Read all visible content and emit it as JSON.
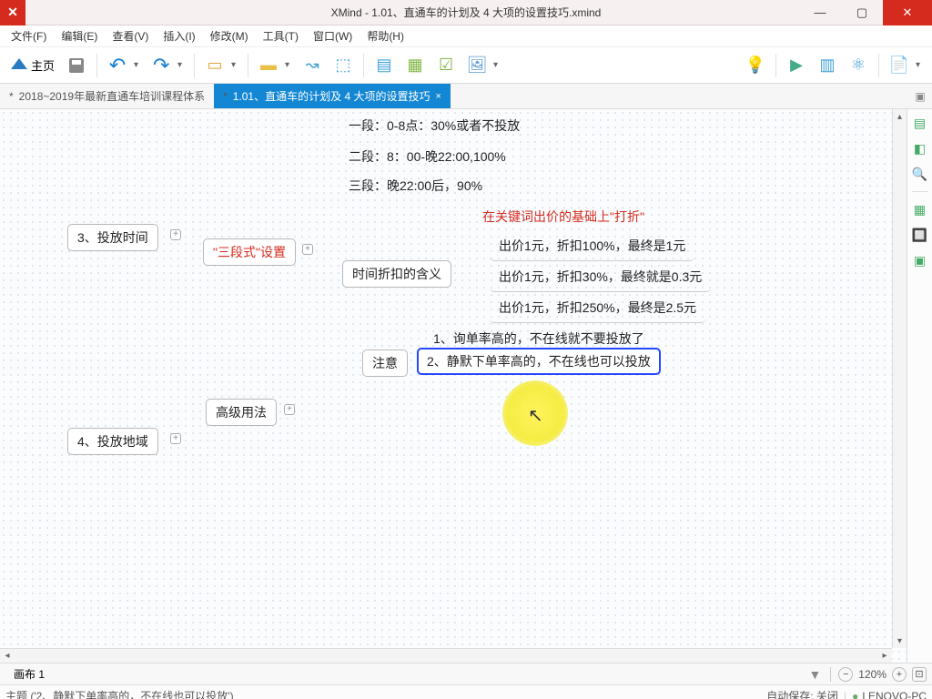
{
  "title": "XMind - 1.01、直通车的计划及 4 大项的设置技巧.xmind",
  "menu": [
    "文件(F)",
    "编辑(E)",
    "查看(V)",
    "插入(I)",
    "修改(M)",
    "工具(T)",
    "窗口(W)",
    "帮助(H)"
  ],
  "toolbar": {
    "home": "主页"
  },
  "tabs": {
    "t1": "2018~2019年最新直通车培训课程体系",
    "t2": "1.01、直通车的计划及 4 大项的设置技巧",
    "t2_close": "×"
  },
  "nodes": {
    "n3": "3、投放时间",
    "n4": "4、投放地域",
    "sanduan": "\"三段式\"设置",
    "gaoji": "高级用法",
    "seg1": "一段：0-8点：30%或者不投放",
    "seg2": "二段：8：00-晚22:00,100%",
    "seg3": "三段：晚22:00后，90%",
    "meaning": "时间折扣的含义",
    "redline": "在关键词出价的基础上\"打折\"",
    "bid1": "出价1元，折扣100%，最终是1元",
    "bid2": "出价1元，折扣30%，最终就是0.3元",
    "bid3": "出价1元，折扣250%，最终是2.5元",
    "attention": "注意",
    "note1": "1、询单率高的，不在线就不要投放了",
    "note2": "2、静默下单率高的，不在线也可以投放"
  },
  "sheet": "画布 1",
  "zoom": {
    "value": "120%"
  },
  "status": {
    "topic": "主题 ('2、静默下单率高的，不在线也可以投放')",
    "autosave": "自动保存: 关闭",
    "host": "LENOVO-PC"
  }
}
